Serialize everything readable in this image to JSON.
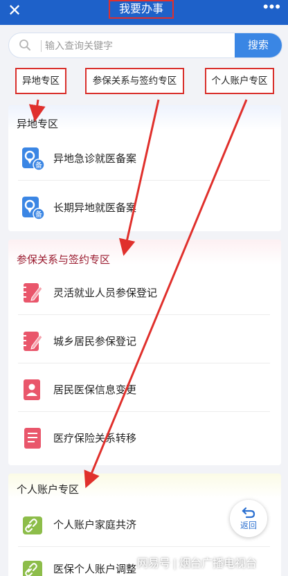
{
  "header": {
    "title": "我要办事",
    "close_icon": "close-icon",
    "more_icon": "more-icon",
    "more_glyph": "•••",
    "close_glyph": "✕"
  },
  "search": {
    "placeholder": "输入查询关键字",
    "button_label": "搜索"
  },
  "quick_tabs": [
    "异地专区",
    "参保关系与签约专区",
    "个人账户专区"
  ],
  "sections": [
    {
      "title": "异地专区",
      "accent": "#3b86e4",
      "items": [
        {
          "label": "异地急诊就医备案",
          "icon": "location-record-icon"
        },
        {
          "label": "长期异地就医备案",
          "icon": "location-record-icon"
        }
      ]
    },
    {
      "title": "参保关系与签约专区",
      "accent": "#e9566b",
      "items": [
        {
          "label": "灵活就业人员参保登记",
          "icon": "notebook-pen-icon"
        },
        {
          "label": "城乡居民参保登记",
          "icon": "notebook-pen-icon"
        },
        {
          "label": "居民医保信息变更",
          "icon": "contact-book-icon"
        },
        {
          "label": "医疗保险关系转移",
          "icon": "document-icon"
        }
      ]
    },
    {
      "title": "个人账户专区",
      "accent": "#8dbd4a",
      "items": [
        {
          "label": "个人账户家庭共济",
          "icon": "link-icon"
        },
        {
          "label": "医保个人账户调整",
          "icon": "link-icon"
        }
      ]
    }
  ],
  "back_button": {
    "label": "返回",
    "icon": "return-icon"
  },
  "watermark": "网易号 | 烟台广播电视台",
  "colors": {
    "topbar": "#1e61c9",
    "annotation_red": "#e0302c",
    "search_button": "#3a86e4"
  }
}
